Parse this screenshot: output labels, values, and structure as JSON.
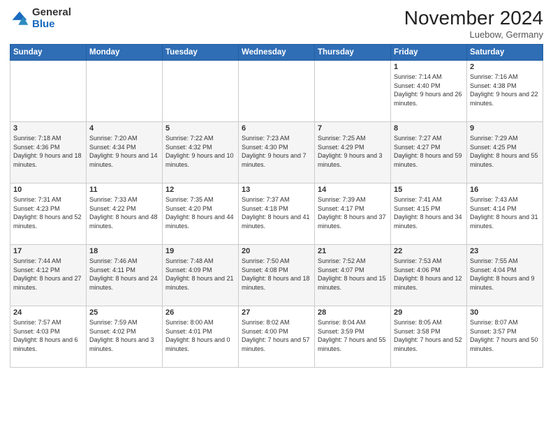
{
  "logo": {
    "general": "General",
    "blue": "Blue"
  },
  "header": {
    "title": "November 2024",
    "location": "Luebow, Germany"
  },
  "weekdays": [
    "Sunday",
    "Monday",
    "Tuesday",
    "Wednesday",
    "Thursday",
    "Friday",
    "Saturday"
  ],
  "rows": [
    [
      {
        "day": "",
        "info": ""
      },
      {
        "day": "",
        "info": ""
      },
      {
        "day": "",
        "info": ""
      },
      {
        "day": "",
        "info": ""
      },
      {
        "day": "",
        "info": ""
      },
      {
        "day": "1",
        "info": "Sunrise: 7:14 AM\nSunset: 4:40 PM\nDaylight: 9 hours and 26 minutes."
      },
      {
        "day": "2",
        "info": "Sunrise: 7:16 AM\nSunset: 4:38 PM\nDaylight: 9 hours and 22 minutes."
      }
    ],
    [
      {
        "day": "3",
        "info": "Sunrise: 7:18 AM\nSunset: 4:36 PM\nDaylight: 9 hours and 18 minutes."
      },
      {
        "day": "4",
        "info": "Sunrise: 7:20 AM\nSunset: 4:34 PM\nDaylight: 9 hours and 14 minutes."
      },
      {
        "day": "5",
        "info": "Sunrise: 7:22 AM\nSunset: 4:32 PM\nDaylight: 9 hours and 10 minutes."
      },
      {
        "day": "6",
        "info": "Sunrise: 7:23 AM\nSunset: 4:30 PM\nDaylight: 9 hours and 7 minutes."
      },
      {
        "day": "7",
        "info": "Sunrise: 7:25 AM\nSunset: 4:29 PM\nDaylight: 9 hours and 3 minutes."
      },
      {
        "day": "8",
        "info": "Sunrise: 7:27 AM\nSunset: 4:27 PM\nDaylight: 8 hours and 59 minutes."
      },
      {
        "day": "9",
        "info": "Sunrise: 7:29 AM\nSunset: 4:25 PM\nDaylight: 8 hours and 55 minutes."
      }
    ],
    [
      {
        "day": "10",
        "info": "Sunrise: 7:31 AM\nSunset: 4:23 PM\nDaylight: 8 hours and 52 minutes."
      },
      {
        "day": "11",
        "info": "Sunrise: 7:33 AM\nSunset: 4:22 PM\nDaylight: 8 hours and 48 minutes."
      },
      {
        "day": "12",
        "info": "Sunrise: 7:35 AM\nSunset: 4:20 PM\nDaylight: 8 hours and 44 minutes."
      },
      {
        "day": "13",
        "info": "Sunrise: 7:37 AM\nSunset: 4:18 PM\nDaylight: 8 hours and 41 minutes."
      },
      {
        "day": "14",
        "info": "Sunrise: 7:39 AM\nSunset: 4:17 PM\nDaylight: 8 hours and 37 minutes."
      },
      {
        "day": "15",
        "info": "Sunrise: 7:41 AM\nSunset: 4:15 PM\nDaylight: 8 hours and 34 minutes."
      },
      {
        "day": "16",
        "info": "Sunrise: 7:43 AM\nSunset: 4:14 PM\nDaylight: 8 hours and 31 minutes."
      }
    ],
    [
      {
        "day": "17",
        "info": "Sunrise: 7:44 AM\nSunset: 4:12 PM\nDaylight: 8 hours and 27 minutes."
      },
      {
        "day": "18",
        "info": "Sunrise: 7:46 AM\nSunset: 4:11 PM\nDaylight: 8 hours and 24 minutes."
      },
      {
        "day": "19",
        "info": "Sunrise: 7:48 AM\nSunset: 4:09 PM\nDaylight: 8 hours and 21 minutes."
      },
      {
        "day": "20",
        "info": "Sunrise: 7:50 AM\nSunset: 4:08 PM\nDaylight: 8 hours and 18 minutes."
      },
      {
        "day": "21",
        "info": "Sunrise: 7:52 AM\nSunset: 4:07 PM\nDaylight: 8 hours and 15 minutes."
      },
      {
        "day": "22",
        "info": "Sunrise: 7:53 AM\nSunset: 4:06 PM\nDaylight: 8 hours and 12 minutes."
      },
      {
        "day": "23",
        "info": "Sunrise: 7:55 AM\nSunset: 4:04 PM\nDaylight: 8 hours and 9 minutes."
      }
    ],
    [
      {
        "day": "24",
        "info": "Sunrise: 7:57 AM\nSunset: 4:03 PM\nDaylight: 8 hours and 6 minutes."
      },
      {
        "day": "25",
        "info": "Sunrise: 7:59 AM\nSunset: 4:02 PM\nDaylight: 8 hours and 3 minutes."
      },
      {
        "day": "26",
        "info": "Sunrise: 8:00 AM\nSunset: 4:01 PM\nDaylight: 8 hours and 0 minutes."
      },
      {
        "day": "27",
        "info": "Sunrise: 8:02 AM\nSunset: 4:00 PM\nDaylight: 7 hours and 57 minutes."
      },
      {
        "day": "28",
        "info": "Sunrise: 8:04 AM\nSunset: 3:59 PM\nDaylight: 7 hours and 55 minutes."
      },
      {
        "day": "29",
        "info": "Sunrise: 8:05 AM\nSunset: 3:58 PM\nDaylight: 7 hours and 52 minutes."
      },
      {
        "day": "30",
        "info": "Sunrise: 8:07 AM\nSunset: 3:57 PM\nDaylight: 7 hours and 50 minutes."
      }
    ]
  ]
}
